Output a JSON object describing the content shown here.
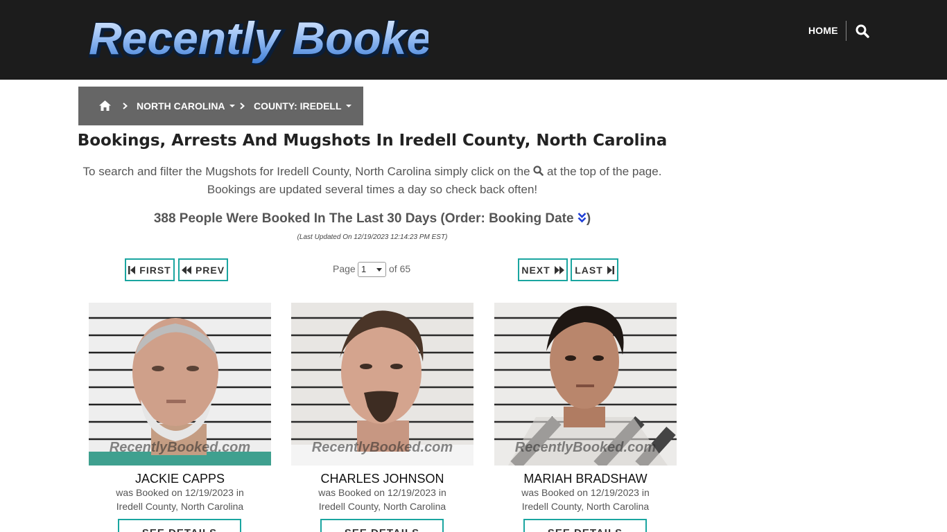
{
  "header": {
    "logo_text": "Recently Booked",
    "nav_home": "HOME",
    "search_icon": "search-icon"
  },
  "breadcrumb": {
    "home_icon": "home-icon",
    "state": "NORTH CAROLINA",
    "county": "COUNTY: IREDELL"
  },
  "main": {
    "title": "Bookings, Arrests And Mugshots In Iredell County, North Carolina",
    "intro_part1": "To search and filter the Mugshots for Iredell County, North Carolina simply click on the",
    "intro_part2": "at the top of the page.",
    "intro_line2": "Bookings are updated several times a day so check back often!",
    "count_text": "388 People Were Booked In The Last 30 Days (Order: Booking Date",
    "count_close": ")",
    "last_updated": "(Last Updated On 12/19/2023 12:14:23 PM EST)"
  },
  "pager": {
    "first": "FIRST",
    "prev": "PREV",
    "next": "NEXT",
    "last": "LAST",
    "page_label": "Page",
    "page_value": "1",
    "of_label": "of 65"
  },
  "cards": [
    {
      "name": "JACKIE CAPPS",
      "line1": "was Booked on 12/19/2023 in",
      "line2": "Iredell County, North Carolina",
      "watermark": "RecentlyBooked.com",
      "button": "SEE DETAILS"
    },
    {
      "name": "CHARLES JOHNSON",
      "line1": "was Booked on 12/19/2023 in",
      "line2": "Iredell County, North Carolina",
      "watermark": "RecentlyBooked.com",
      "button": "SEE DETAILS"
    },
    {
      "name": "MARIAH BRADSHAW",
      "line1": "was Booked on 12/19/2023 in",
      "line2": "Iredell County, North Carolina",
      "watermark": "RecentlyBooked.com",
      "button": "SEE DETAILS"
    }
  ],
  "colors": {
    "header_bg": "#1c1c1c",
    "breadcrumb_bg": "#666666",
    "accent_teal": "#1aa5a0",
    "sort_icon_blue": "#1f3fd6"
  }
}
